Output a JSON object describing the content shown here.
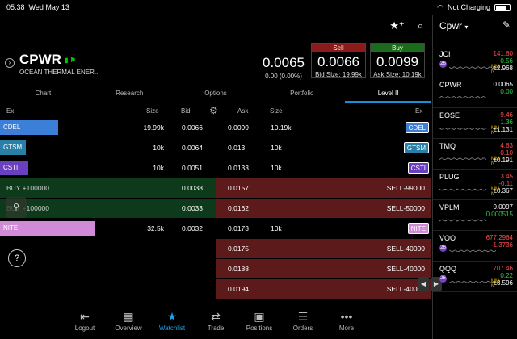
{
  "status": {
    "time": "05:38",
    "date": "Wed May 13",
    "battery": "Not Charging"
  },
  "quote": {
    "symbol": "CPWR",
    "company": "OCEAN THERMAL ENER...",
    "last": "0.0065",
    "change": "0.00 (0.00%)",
    "sell_label": "Sell",
    "bid": "0.0066",
    "bid_size": "Bid Size: 19.99k",
    "buy_label": "Buy",
    "ask": "0.0099",
    "ask_size": "Ask Size: 10.19k"
  },
  "tabs": [
    "Chart",
    "Research",
    "Options",
    "Portfolio",
    "Level II"
  ],
  "columns": {
    "ex_left": "Ex",
    "size_left": "Size",
    "bid": "Bid",
    "ask": "Ask",
    "size_right": "Size",
    "ex_right": "Ex"
  },
  "book": [
    {
      "bid_mm": "CDEL",
      "bid_color": "#3b7fd8",
      "bid_bar": 0.27,
      "bid_size": "19.99k",
      "bid": "0.0066",
      "ask": "0.0099",
      "ask_size": "10.19k",
      "ask_mm": "CDEL",
      "ask_color": "#3b7fd8",
      "bg": "none"
    },
    {
      "bid_mm": "GTSM",
      "bid_color": "#2a7fa6",
      "bid_bar": 0.12,
      "bid_size": "10k",
      "bid": "0.0064",
      "ask": "0.013",
      "ask_size": "10k",
      "ask_mm": "GTSM",
      "ask_color": "#2a7fa6",
      "bg": "none"
    },
    {
      "bid_mm": "CSTI",
      "bid_color": "#6a3fc0",
      "bid_bar": 0.13,
      "bid_size": "10k",
      "bid": "0.0051",
      "ask": "0.0133",
      "ask_size": "10k",
      "ask_mm": "CSTI",
      "ask_color": "#6a3fc0",
      "bg": "none"
    },
    {
      "bid_mm": "BUY +100000",
      "bid_color": "",
      "bid_bar": 0,
      "bid_size": "",
      "bid": "0.0038",
      "ask": "0.0157",
      "ask_size": "",
      "ask_mm": "SELL-99000",
      "ask_color": "",
      "bg": "both"
    },
    {
      "bid_mm": "BUY +100000",
      "bid_color": "",
      "bid_bar": 0,
      "bid_size": "",
      "bid": "0.0033",
      "ask": "0.0162",
      "ask_size": "",
      "ask_mm": "SELL-50000",
      "ask_color": "",
      "bg": "both"
    },
    {
      "bid_mm": "NITE",
      "bid_color": "#d08ad8",
      "bid_bar": 0.44,
      "bid_size": "32.5k",
      "bid": "0.0032",
      "ask": "0.0173",
      "ask_size": "10k",
      "ask_mm": "NITE",
      "ask_color": "#d08ad8",
      "bg": "none"
    },
    {
      "bid_mm": "",
      "bid_color": "",
      "bid_bar": 0,
      "bid_size": "",
      "bid": "",
      "ask": "0.0175",
      "ask_size": "",
      "ask_mm": "SELL-40000",
      "ask_color": "",
      "bg": "ask"
    },
    {
      "bid_mm": "",
      "bid_color": "",
      "bid_bar": 0,
      "bid_size": "",
      "bid": "",
      "ask": "0.0188",
      "ask_size": "",
      "ask_mm": "SELL-40000",
      "ask_color": "",
      "bg": "ask"
    },
    {
      "bid_mm": "",
      "bid_color": "",
      "bid_bar": 0,
      "bid_size": "",
      "bid": "",
      "ask": "0.0194",
      "ask_size": "",
      "ask_mm": "SELL-40000",
      "ask_color": "",
      "bg": "ask"
    }
  ],
  "nav": [
    {
      "label": "Logout",
      "icon": "logout-icon",
      "glyph": "⇤"
    },
    {
      "label": "Overview",
      "icon": "overview-icon",
      "glyph": "▦"
    },
    {
      "label": "Watchlist",
      "icon": "watchlist-icon",
      "glyph": "★"
    },
    {
      "label": "Trade",
      "icon": "trade-icon",
      "glyph": "⇄"
    },
    {
      "label": "Positions",
      "icon": "positions-icon",
      "glyph": "▣"
    },
    {
      "label": "Orders",
      "icon": "orders-icon",
      "glyph": "☰"
    },
    {
      "label": "More",
      "icon": "more-icon",
      "glyph": "•••"
    }
  ],
  "watchlist": {
    "title": "Cpwr",
    "items": [
      {
        "symbol": "JCI",
        "price": "141.60",
        "change": "0.56",
        "pct": "±2.968",
        "color": "red",
        "badge": "26",
        "mm": true
      },
      {
        "symbol": "CPWR",
        "price": "0.0065",
        "change": "0.00",
        "pct": "",
        "color": "white",
        "badge": "",
        "mm": false
      },
      {
        "symbol": "EOSE",
        "price": "9.46",
        "change": "1.36",
        "pct": "±1.131",
        "color": "red",
        "badge": "",
        "mm": true
      },
      {
        "symbol": "TMQ",
        "price": "4.63",
        "change": "-0.10",
        "pct": "±0.191",
        "color": "red",
        "badge": "",
        "mm": true
      },
      {
        "symbol": "PLUG",
        "price": "3.45",
        "change": "-0.11",
        "pct": "±0.367",
        "color": "red",
        "badge": "",
        "mm": true
      },
      {
        "symbol": "VPLM",
        "price": "0.0097",
        "change": "0.000515",
        "pct": "",
        "color": "white",
        "badge": "",
        "mm": false
      },
      {
        "symbol": "VOO",
        "price": "677.2964",
        "change": "-1.3736",
        "pct": "",
        "color": "red",
        "badge": "26",
        "mm": false
      },
      {
        "symbol": "QQQ",
        "price": "707.46",
        "change": "0.22",
        "pct": "±3.596",
        "color": "red",
        "badge": "26",
        "mm": true
      }
    ]
  }
}
